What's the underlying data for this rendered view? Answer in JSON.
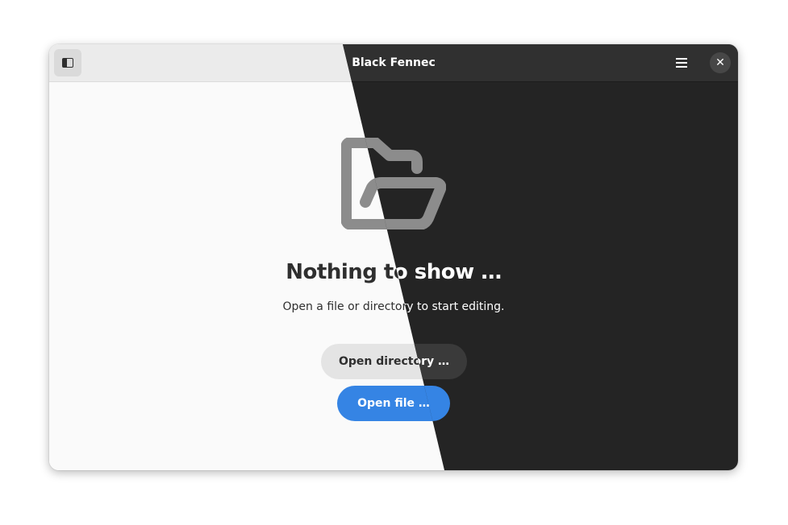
{
  "window": {
    "title": "Black Fennec"
  },
  "headerbar": {
    "sidebar_toggle_icon": "sidebar-show-icon",
    "menu_icon": "hamburger-menu-icon",
    "close_icon": "close-icon",
    "close_glyph": "✕"
  },
  "empty_state": {
    "icon": "folder-open-icon",
    "heading": "Nothing to show …",
    "description": "Open  a file or directory to start editing.",
    "open_directory_label": "Open directory …",
    "open_file_label": "Open file …"
  },
  "colors": {
    "accent": "#3584e4",
    "light_bg": "#fafafa",
    "dark_bg": "#242424",
    "icon_gray": "#8c8c8c"
  }
}
